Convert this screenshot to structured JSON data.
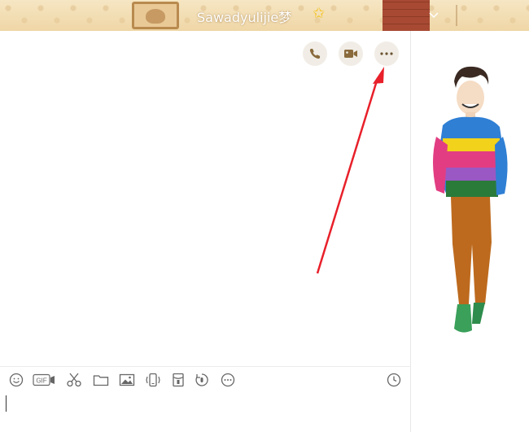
{
  "window": {
    "contact_name": "Sawadyulijie梦",
    "title_star": "✩"
  },
  "header_actions": [
    {
      "name": "voice-call",
      "icon": "phone-icon"
    },
    {
      "name": "video-call",
      "icon": "video-camera-icon"
    },
    {
      "name": "more",
      "icon": "ellipsis-icon"
    }
  ],
  "toolbar": {
    "gif_label": "GIF",
    "tools": [
      "emoji-icon",
      "gif-icon",
      "scissors-icon",
      "folder-icon",
      "image-icon",
      "shake-icon",
      "red-packet-icon",
      "voice-message-icon",
      "more-tools-icon",
      "history-clock-icon"
    ]
  },
  "input": {
    "value": ""
  },
  "colors": {
    "skin_beige": "#efd6a6",
    "action_button_bg": "#f1ede6",
    "action_icon": "#8a6a3c",
    "annotation_arrow": "#e8202a"
  },
  "avatar_show": {
    "description_icon": "avatar-character-icon"
  }
}
